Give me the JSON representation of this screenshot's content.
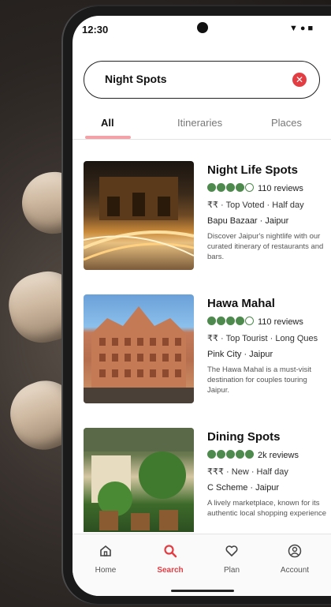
{
  "status_bar": {
    "time": "12:30",
    "icons": "▼●■"
  },
  "search": {
    "query": "Night Spots",
    "clear_icon": "close-icon"
  },
  "tabs": [
    {
      "label": "All",
      "active": true
    },
    {
      "label": "Itineraries",
      "active": false
    },
    {
      "label": "Places",
      "active": false
    }
  ],
  "results": [
    {
      "title": "Night Life Spots",
      "rating": 4,
      "reviews": "110 reviews",
      "meta": "₹₹ · Top Voted · Half day",
      "location": "Bapu Bazaar · Jaipur",
      "description": "Discover Jaipur's nightlife with our curated itinerary of restaurants and bars."
    },
    {
      "title": "Hawa Mahal",
      "rating": 4,
      "reviews": "110 reviews",
      "meta": "₹₹ · Top Tourist · Long Ques",
      "location": "Pink City · Jaipur",
      "description": "The Hawa Mahal is a must-visit destination for couples touring Jaipur."
    },
    {
      "title": "Dining Spots",
      "rating": 5,
      "reviews": "2k reviews",
      "meta": "₹₹₹ · New · Half day",
      "location": "C Scheme · Jaipur",
      "description": "A lively marketplace, known for its authentic local shopping experience"
    }
  ],
  "bottom_nav": [
    {
      "label": "Home",
      "icon": "home-icon",
      "active": false
    },
    {
      "label": "Search",
      "icon": "search-icon",
      "active": true
    },
    {
      "label": "Plan",
      "icon": "heart-icon",
      "active": false
    },
    {
      "label": "Account",
      "icon": "account-icon",
      "active": false
    }
  ],
  "colors": {
    "accent": "#e23d43",
    "rating": "#4e8a4d",
    "tab_underline": "#f3a3a7"
  }
}
